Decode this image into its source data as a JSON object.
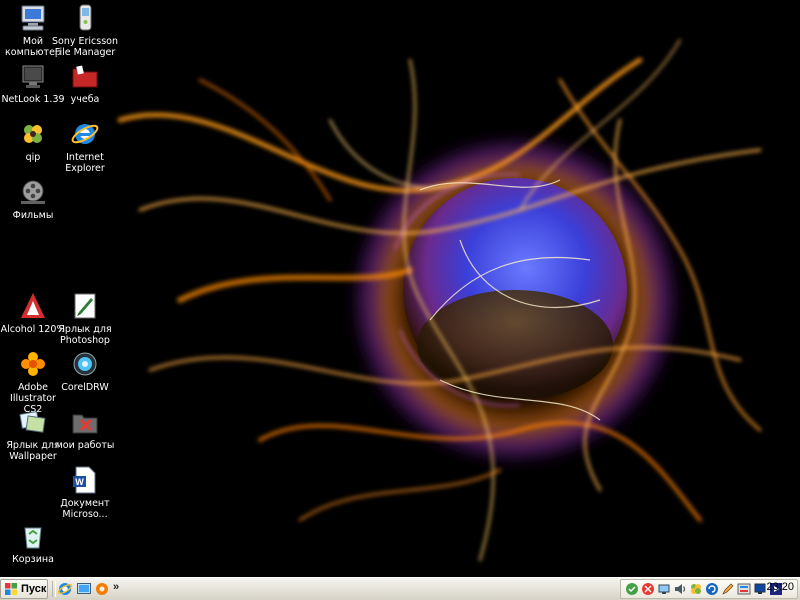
{
  "desktop": {
    "icons": [
      {
        "id": "my-computer",
        "label": "Мой\nкомпьютер",
        "icon": "my-computer-icon"
      },
      {
        "id": "sony-ericsson",
        "label": "Sony Ericsson\nFile Manager",
        "icon": "phone-icon"
      },
      {
        "id": "netlook",
        "label": "NetLook 1.39",
        "icon": "netlook-icon"
      },
      {
        "id": "ucheba",
        "label": "учеба",
        "icon": "folder-red-icon"
      },
      {
        "id": "qip",
        "label": "qip",
        "icon": "qip-flower-icon"
      },
      {
        "id": "ie",
        "label": "Internet\nExplorer",
        "icon": "internet-explorer-icon"
      },
      {
        "id": "filmy",
        "label": "Фильмы",
        "icon": "film-reel-icon"
      },
      {
        "id": "alcohol",
        "label": "Alcohol 120%",
        "icon": "alcohol-icon"
      },
      {
        "id": "photoshop",
        "label": "Ярлык для\nPhotoshop",
        "icon": "photoshop-icon"
      },
      {
        "id": "illustrator",
        "label": "Adobe\nIllustrator CS2",
        "icon": "illustrator-flower-icon"
      },
      {
        "id": "coreldraw",
        "label": "CorelDRW",
        "icon": "coreldraw-icon"
      },
      {
        "id": "wallpaper",
        "label": "Ярлык для\nWallpaper",
        "icon": "wallpaper-icon"
      },
      {
        "id": "moi-raboty",
        "label": "мои работы",
        "icon": "folder-works-icon"
      },
      {
        "id": "document",
        "label": "Документ\nMicroso...",
        "icon": "word-document-icon"
      },
      {
        "id": "recycle-bin",
        "label": "Корзина",
        "icon": "recycle-bin-icon"
      }
    ]
  },
  "taskbar": {
    "start_label": "Пуск",
    "quick_launch": [
      "internet-explorer-icon",
      "desktop-icon",
      "media-icon"
    ],
    "overflow_label": "»",
    "tray_icons": [
      "green-shield-icon",
      "red-antivirus-icon",
      "network-icon",
      "speaker-icon",
      "qip-tray-icon",
      "update-icon",
      "pen-icon",
      "language-icon",
      "monitor-icon",
      "media-player-icon"
    ],
    "clock": "23:20"
  },
  "colors": {
    "desktop_bg": "#000000",
    "taskbar_bg": "#ECE9D8",
    "icon_label": "#ffffff"
  }
}
